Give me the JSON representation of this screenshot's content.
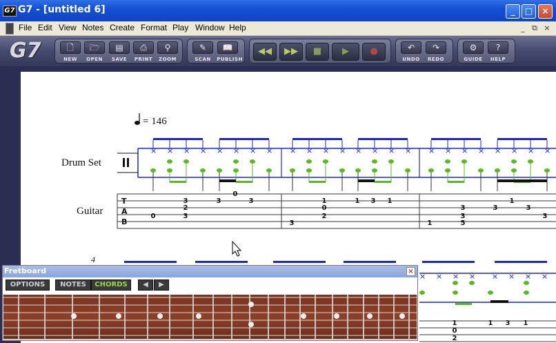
{
  "window": {
    "title": "G7 - [untitled 6]",
    "app_icon_text": "G7",
    "minimize_glyph": "_",
    "maximize_glyph": "□",
    "close_glyph": "×"
  },
  "menu": {
    "items": [
      "File",
      "Edit",
      "View",
      "Notes",
      "Create",
      "Format",
      "Play",
      "Window",
      "Help"
    ],
    "mdi_minimize": "_",
    "mdi_restore": "⧉",
    "mdi_close": "×"
  },
  "toolbar": {
    "logo": "G7",
    "buttons": [
      {
        "label": "NEW",
        "icon": "new-doc-icon",
        "glyph": "🗋"
      },
      {
        "label": "OPEN",
        "icon": "open-folder-icon",
        "glyph": "🗁"
      },
      {
        "label": "SAVE",
        "icon": "save-icon",
        "glyph": "▤"
      },
      {
        "label": "PRINT",
        "icon": "printer-icon",
        "glyph": "⎙"
      },
      {
        "label": "ZOOM",
        "icon": "zoom-icon",
        "glyph": "⚲"
      },
      {
        "label": "SCAN",
        "icon": "scan-icon",
        "glyph": "✎"
      },
      {
        "label": "PUBLISH",
        "icon": "book-icon",
        "glyph": "📖"
      },
      {
        "label": "UNDO",
        "icon": "undo-icon",
        "glyph": "↶"
      },
      {
        "label": "REDO",
        "icon": "redo-icon",
        "glyph": "↷"
      },
      {
        "label": "GUIDE",
        "icon": "guide-icon",
        "glyph": "⚙"
      },
      {
        "label": "HELP",
        "icon": "help-icon",
        "glyph": "?"
      }
    ],
    "transport": [
      {
        "name": "rewind-icon",
        "glyph": "◀◀",
        "color": "#b8c86a"
      },
      {
        "name": "fast-forward-icon",
        "glyph": "▶▶",
        "color": "#b8c86a"
      },
      {
        "name": "stop-icon",
        "glyph": "■",
        "color": "#8a9a58"
      },
      {
        "name": "play-icon",
        "glyph": "▶",
        "color": "#8a9a58"
      },
      {
        "name": "record-icon",
        "glyph": "●",
        "color": "#b04848"
      }
    ]
  },
  "score": {
    "tempo": "= 146",
    "tracks": [
      "Drum Set",
      "Guitar"
    ],
    "tab_letters": [
      "T",
      "A",
      "B"
    ],
    "system2_measure_number": "4",
    "tab_row1": {
      "string2": [
        "3",
        "3",
        "3",
        "1",
        "1",
        "3",
        "1",
        "1"
      ],
      "string3": [
        "2",
        "0",
        "3"
      ],
      "string4": [
        "3",
        "2",
        "3"
      ],
      "string5": [
        "0",
        "3",
        "5"
      ],
      "string6": [
        "3",
        "1"
      ],
      "extra": [
        "0",
        "3",
        "3"
      ]
    },
    "tab_row2": [
      "1",
      "1",
      "3",
      "1",
      "0",
      "2"
    ]
  },
  "fretboard": {
    "title": "Fretboard",
    "close_glyph": "×",
    "options_label": "OPTIONS",
    "notes_label": "NOTES",
    "chords_label": "CHORDS",
    "prev_glyph": "◀",
    "next_glyph": "▶"
  },
  "colors": {
    "staff_blue": "#1a24c8",
    "note_green": "#5ab820",
    "title_blue": "#1450d4"
  }
}
